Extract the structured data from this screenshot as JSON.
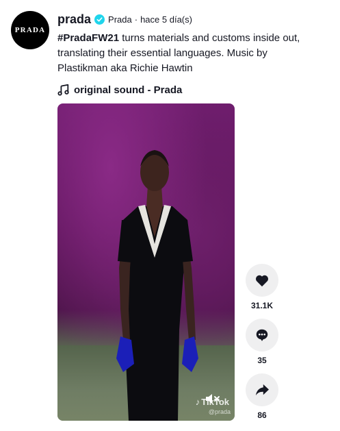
{
  "post": {
    "avatar_text": "PRADA",
    "username": "prada",
    "nickname": "Prada",
    "separator": "·",
    "time": "hace 5 día(s)",
    "caption_hashtag": "#PradaFW21",
    "caption_text": " turns materials and customs inside out, translating their essential languages. Music by Plastikman aka Richie Hawtin",
    "music": "original sound - Prada"
  },
  "video": {
    "watermark": "TikTok",
    "watermark_user": "@prada"
  },
  "actions": {
    "likes": "31.1K",
    "comments": "35",
    "shares": "86"
  },
  "colors": {
    "verified": "#20d5ec",
    "text": "#161823",
    "action_bg": "#efeff0"
  }
}
